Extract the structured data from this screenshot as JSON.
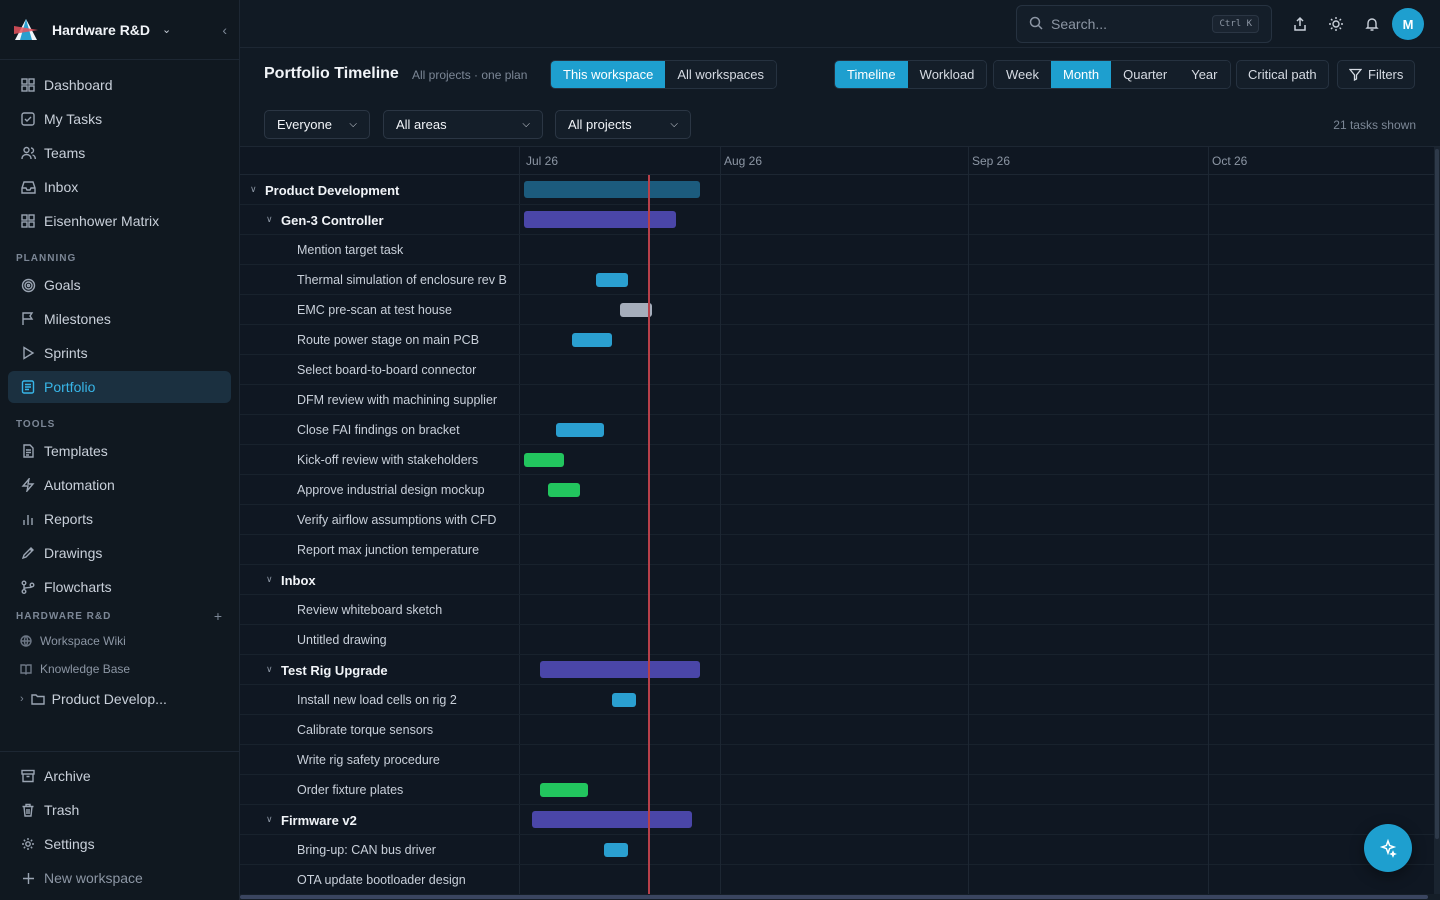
{
  "workspace": {
    "name": "Hardware R&D"
  },
  "nav": [
    {
      "label": "Dashboard",
      "icon": "grid-icon"
    },
    {
      "label": "My Tasks",
      "icon": "check-square-icon"
    },
    {
      "label": "Teams",
      "icon": "users-icon"
    },
    {
      "label": "Inbox",
      "icon": "inbox-icon"
    },
    {
      "label": "Eisenhower Matrix",
      "icon": "matrix-icon"
    }
  ],
  "planning": {
    "label": "PLANNING",
    "items": [
      {
        "label": "Goals",
        "icon": "target-icon"
      },
      {
        "label": "Milestones",
        "icon": "flag-icon"
      },
      {
        "label": "Sprints",
        "icon": "play-icon"
      },
      {
        "label": "Portfolio",
        "icon": "portfolio-icon",
        "active": true
      }
    ]
  },
  "tools": {
    "label": "TOOLS",
    "items": [
      {
        "label": "Templates",
        "icon": "template-icon"
      },
      {
        "label": "Automation",
        "icon": "bolt-icon"
      },
      {
        "label": "Reports",
        "icon": "bar-chart-icon"
      },
      {
        "label": "Drawings",
        "icon": "pen-icon"
      },
      {
        "label": "Flowcharts",
        "icon": "flowchart-icon"
      }
    ]
  },
  "wsSection": {
    "label": "HARDWARE R&D",
    "items": [
      {
        "label": "Workspace Wiki",
        "icon": "globe-icon"
      },
      {
        "label": "Knowledge Base",
        "icon": "book-icon"
      }
    ],
    "folder": "Product Develop..."
  },
  "bottom": [
    {
      "label": "Archive",
      "icon": "archive-icon"
    },
    {
      "label": "Trash",
      "icon": "trash-icon"
    },
    {
      "label": "Settings",
      "icon": "gear-icon"
    },
    {
      "label": "New workspace",
      "icon": "plus-icon"
    }
  ],
  "search": {
    "placeholder": "Search...",
    "shortcut": "Ctrl K"
  },
  "user": {
    "initial": "M"
  },
  "page": {
    "title": "Portfolio Timeline",
    "subtitle": "All projects · one plan",
    "scope": [
      "This workspace",
      "All workspaces"
    ],
    "view": [
      "Timeline",
      "Workload"
    ],
    "zoom": [
      "Week",
      "Month",
      "Quarter",
      "Year"
    ],
    "criticalPath": "Critical path",
    "filters": "Filters"
  },
  "filterbar": {
    "people": "Everyone",
    "areas": "All areas",
    "projects": "All projects",
    "count": "21 tasks shown"
  },
  "timeline": {
    "dates": [
      "Jul 26",
      "Aug 26",
      "Sep 26",
      "Oct 26"
    ],
    "rows": [
      {
        "label": "Product Development",
        "level": 0,
        "group": true,
        "bar": [
          26,
          70
        ],
        "color": "#1c5b7d"
      },
      {
        "label": "Gen-3 Controller",
        "level": 1,
        "group": true,
        "bar": [
          26,
          64
        ],
        "color": "#4a46a8"
      },
      {
        "label": "Mention target task",
        "level": 2
      },
      {
        "label": "Thermal simulation of enclosure rev B",
        "level": 2,
        "bar": [
          44,
          52
        ],
        "color": "#2a9fd0"
      },
      {
        "label": "EMC pre-scan at test house",
        "level": 2,
        "bar": [
          50,
          58
        ],
        "color": "#a5adbb"
      },
      {
        "label": "Route power stage on main PCB",
        "level": 2,
        "bar": [
          38,
          48
        ],
        "color": "#2a9fd0"
      },
      {
        "label": "Select board-to-board connector",
        "level": 2
      },
      {
        "label": "DFM review with machining supplier",
        "level": 2
      },
      {
        "label": "Close FAI findings on bracket",
        "level": 2,
        "bar": [
          34,
          46
        ],
        "color": "#2a9fd0"
      },
      {
        "label": "Kick-off review with stakeholders",
        "level": 2,
        "bar": [
          26,
          36
        ],
        "color": "#22c55e"
      },
      {
        "label": "Approve industrial design mockup",
        "level": 2,
        "bar": [
          32,
          40
        ],
        "color": "#22c55e"
      },
      {
        "label": "Verify airflow assumptions with CFD",
        "level": 2
      },
      {
        "label": "Report max junction temperature",
        "level": 2
      },
      {
        "label": "Inbox",
        "level": 1,
        "group": true
      },
      {
        "label": "Review whiteboard sketch",
        "level": 2
      },
      {
        "label": "Untitled drawing",
        "level": 2
      },
      {
        "label": "Test Rig Upgrade",
        "level": 1,
        "group": true,
        "bar": [
          30,
          70
        ],
        "color": "#4a46a8"
      },
      {
        "label": "Install new load cells on rig 2",
        "level": 2,
        "bar": [
          48,
          54
        ],
        "color": "#2a9fd0"
      },
      {
        "label": "Calibrate torque sensors",
        "level": 2
      },
      {
        "label": "Write rig safety procedure",
        "level": 2
      },
      {
        "label": "Order fixture plates",
        "level": 2,
        "bar": [
          30,
          42
        ],
        "color": "#22c55e"
      },
      {
        "label": "Firmware v2",
        "level": 1,
        "group": true,
        "bar": [
          28,
          68
        ],
        "color": "#4a46a8"
      },
      {
        "label": "Bring-up: CAN bus driver",
        "level": 2,
        "bar": [
          46,
          52
        ],
        "color": "#2a9fd0"
      },
      {
        "label": "OTA update bootloader design",
        "level": 2
      }
    ]
  }
}
